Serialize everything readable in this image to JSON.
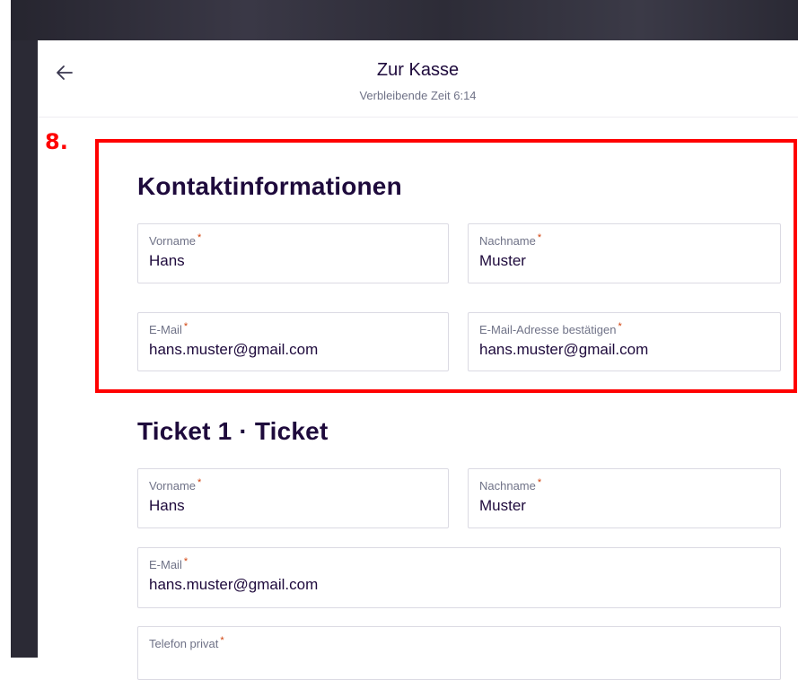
{
  "header": {
    "title": "Zur Kasse",
    "subtitle": "Verbleibende Zeit 6:14"
  },
  "annotation": {
    "step_label": "8.",
    "highlight_color": "#ff0000"
  },
  "contact": {
    "heading": "Kontaktinformationen",
    "first_name": {
      "label": "Vorname",
      "value": "Hans"
    },
    "last_name": {
      "label": "Nachname",
      "value": "Muster"
    },
    "email": {
      "label": "E-Mail",
      "value": "hans.muster@gmail.com"
    },
    "email_confirm": {
      "label": "E-Mail-Adresse bestätigen",
      "value": "hans.muster@gmail.com"
    }
  },
  "ticket": {
    "heading": "Ticket 1 · Ticket",
    "first_name": {
      "label": "Vorname",
      "value": "Hans"
    },
    "last_name": {
      "label": "Nachname",
      "value": "Muster"
    },
    "email": {
      "label": "E-Mail",
      "value": "hans.muster@gmail.com"
    },
    "phone": {
      "label": "Telefon privat",
      "value": ""
    }
  },
  "required_marker": "*",
  "colors": {
    "required": "#d1410c",
    "heading": "#1e0a3c",
    "backdrop": "#2b2a35"
  }
}
